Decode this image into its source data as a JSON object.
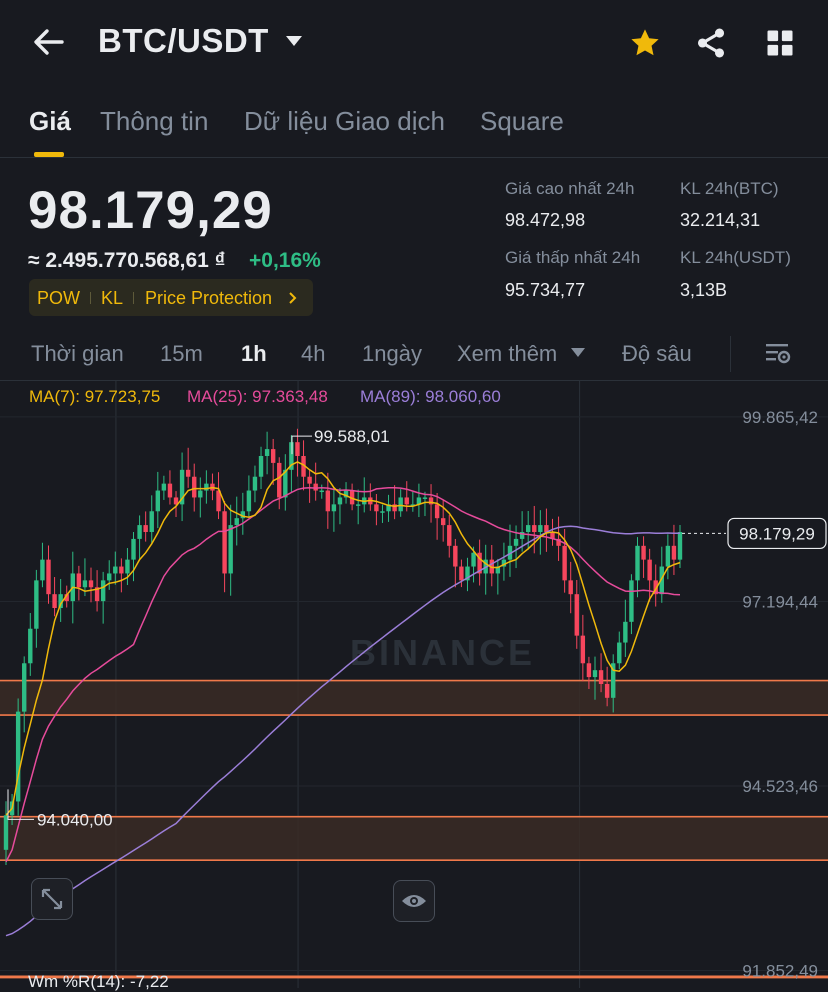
{
  "header": {
    "title": "BTC/USDT",
    "icons": [
      "back-arrow-icon",
      "dropdown-caret-icon",
      "star-icon",
      "share-icon",
      "grid-menu-icon"
    ],
    "star_color": "#f0b90b"
  },
  "tabs": [
    {
      "label": "Giá",
      "active": true
    },
    {
      "label": "Thông tin",
      "active": false
    },
    {
      "label": "Dữ liệu Giao dịch",
      "active": false
    },
    {
      "label": "Square",
      "active": false
    }
  ],
  "price": {
    "last": "98.179,29",
    "fiat": "≈ 2.495.770.568,61 ₫",
    "change": "+0,16%",
    "change_color": "#2ebd85"
  },
  "tags": [
    "POW",
    "KL",
    "Price Protection"
  ],
  "stats": {
    "high_label": "Giá cao nhất 24h",
    "high_value": "98.472,98",
    "low_label": "Giá thấp nhất 24h",
    "low_value": "95.734,77",
    "vol_btc_label": "KL 24h(BTC)",
    "vol_btc_value": "32.214,31",
    "vol_usdt_label": "KL 24h(USDT)",
    "vol_usdt_value": "3,13B"
  },
  "intervals": [
    {
      "label": "Thời gian",
      "active": false
    },
    {
      "label": "15m",
      "active": false
    },
    {
      "label": "1h",
      "active": true
    },
    {
      "label": "4h",
      "active": false
    },
    {
      "label": "1ngày",
      "active": false
    },
    {
      "label": "Xem thêm",
      "active": false
    },
    {
      "label": "Độ sâu",
      "active": false
    }
  ],
  "ma_legend": {
    "ma7": "MA(7): 97.723,75",
    "ma25": "MA(25): 97.363,48",
    "ma89": "MA(89): 98.060,60",
    "colors": {
      "ma7": "#f0b90b",
      "ma25": "#e64b9b",
      "ma89": "#9b7ed8"
    }
  },
  "chart_data": {
    "type": "candlestick",
    "y_ticks": [
      "99.865,42",
      "97.194,44",
      "94.523,46",
      "91.852,49"
    ],
    "y_tick_values": [
      99865.42,
      97194.44,
      94523.46,
      91852.49
    ],
    "ylim": [
      91600,
      100400
    ],
    "high_annotation": "99.588,01",
    "high_value": 99588.01,
    "low_annotation": "94.040,00",
    "low_value": 94040.0,
    "current_price_label": "98.179,29",
    "current_price": 98179.29,
    "watermark": "BINANCE",
    "up_color": "#2ebd85",
    "down_color": "#f6465d",
    "zones": [
      {
        "from": 95550,
        "to": 96050
      },
      {
        "from": 93450,
        "to": 94080
      },
      {
        "from": 91750,
        "to": 91770
      }
    ],
    "closes": [
      94100,
      94300,
      95600,
      96300,
      96800,
      97500,
      97800,
      97300,
      97100,
      97300,
      97200,
      97600,
      97400,
      97500,
      97400,
      97200,
      97500,
      97600,
      97700,
      97600,
      97800,
      98100,
      98300,
      98200,
      98500,
      98800,
      98900,
      98700,
      98600,
      99100,
      99000,
      98700,
      98800,
      98900,
      98800,
      98500,
      97600,
      98300,
      98400,
      98500,
      98800,
      99000,
      99300,
      99400,
      99200,
      98700,
      99100,
      99500,
      99300,
      99000,
      98900,
      98800,
      98800,
      98500,
      98600,
      98700,
      98800,
      98600,
      98600,
      98700,
      98600,
      98500,
      98500,
      98600,
      98500,
      98700,
      98600,
      98600,
      98700,
      98700,
      98600,
      98400,
      98300,
      98000,
      97700,
      97500,
      97700,
      97900,
      97600,
      97800,
      97600,
      97700,
      97800,
      98000,
      98100,
      98200,
      98300,
      98200,
      98300,
      98200,
      98100,
      98000,
      97500,
      97300,
      96700,
      96300,
      96100,
      96200,
      96000,
      95800,
      96300,
      96600,
      96900,
      97500,
      98000,
      97800,
      97500,
      97300,
      97700,
      98000,
      97800,
      98200
    ]
  },
  "watermark_indicator": "Wm %R(14): -7,22"
}
